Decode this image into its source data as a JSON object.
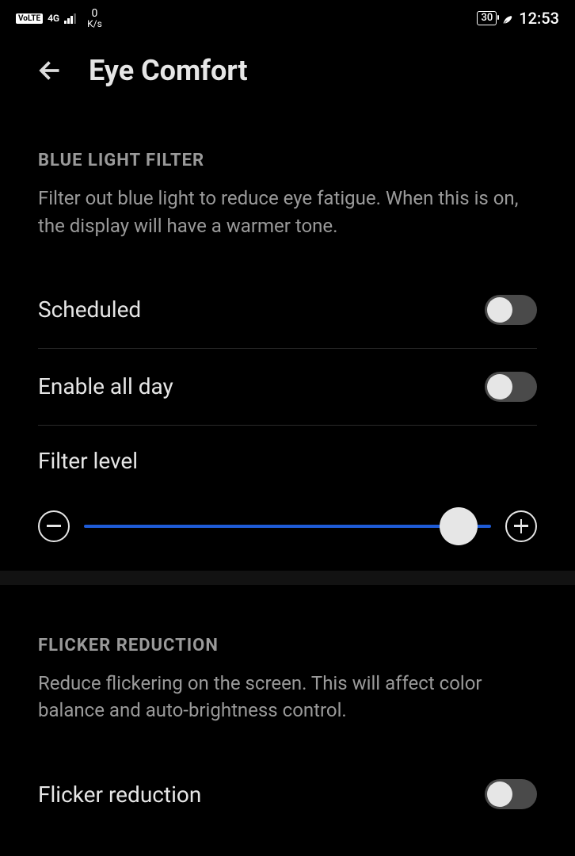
{
  "status": {
    "volte": "VoLTE",
    "network_gen": "4G",
    "net_speed_value": "0",
    "net_speed_unit": "K/s",
    "battery_pct": "30",
    "time": "12:53"
  },
  "header": {
    "title": "Eye Comfort"
  },
  "sections": {
    "blue_light": {
      "title": "BLUE LIGHT FILTER",
      "description": "Filter out blue light to reduce eye fatigue. When this is on, the display will have a warmer tone.",
      "scheduled_label": "Scheduled",
      "enable_all_day_label": "Enable all day",
      "filter_level_label": "Filter level"
    },
    "flicker": {
      "title": "FLICKER REDUCTION",
      "description": "Reduce flickering on the screen. This will affect color balance and auto-brightness control.",
      "flicker_reduction_label": "Flicker reduction"
    }
  }
}
